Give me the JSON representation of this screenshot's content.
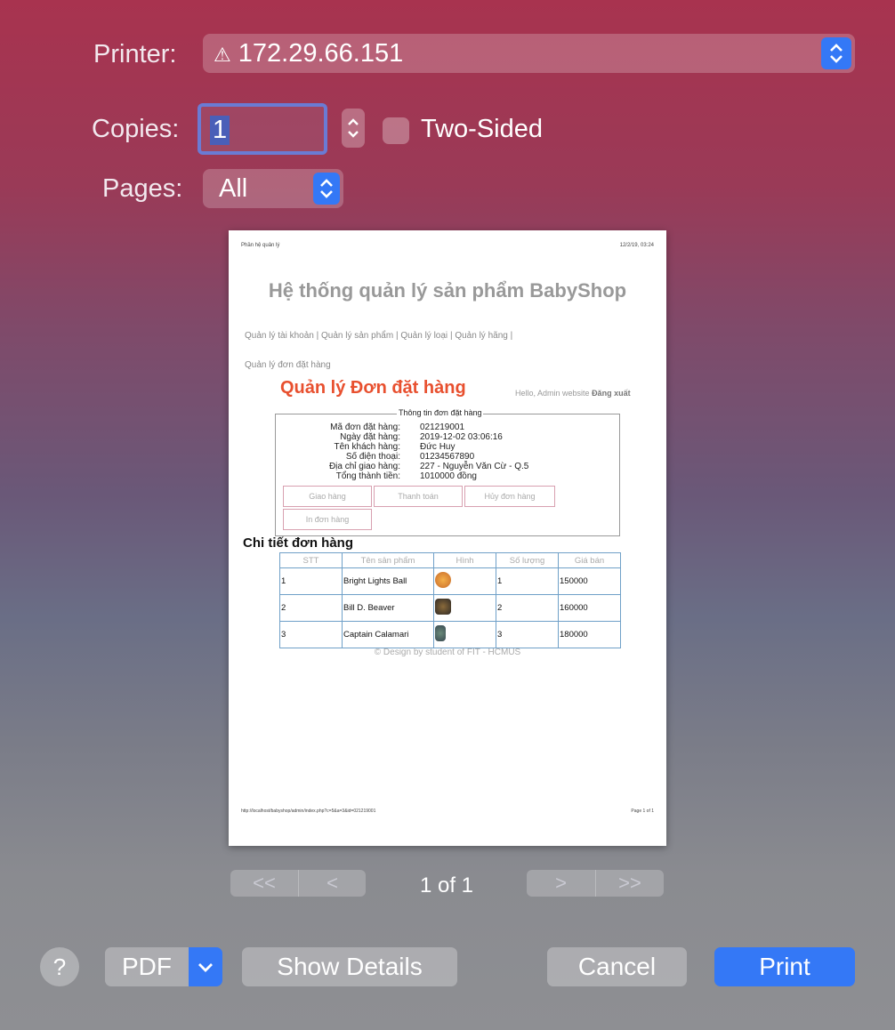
{
  "printer": {
    "label": "Printer:",
    "value": "172.29.66.151"
  },
  "copies": {
    "label": "Copies:",
    "value": "1"
  },
  "two_sided": {
    "label": "Two-Sided",
    "checked": false
  },
  "pages": {
    "label": "Pages:",
    "value": "All"
  },
  "preview": {
    "header_left": "Phần hệ quản lý",
    "header_right": "12/2/19, 03:24",
    "site_title": "Hệ thống quản lý sản phẩm BabyShop",
    "nav": [
      "Quản lý tài khoản",
      "Quản lý sản phẩm",
      "Quản lý loại",
      "Quản lý hãng",
      "Quản lý đơn đặt hàng"
    ],
    "nav_sep": "|",
    "page_title": "Quản lý Đơn đặt hàng",
    "hello": "Hello, Admin website",
    "logout": "Đăng xuất",
    "info_legend": "Thông tin đơn đặt hàng",
    "info": [
      {
        "label": "Mã đơn đặt hàng:",
        "value": "021219001"
      },
      {
        "label": "Ngày đặt hàng:",
        "value": "2019-12-02 03:06:16"
      },
      {
        "label": "Tên khách hàng:",
        "value": "Đức Huy"
      },
      {
        "label": "Số điện thoại:",
        "value": "01234567890"
      },
      {
        "label": "Địa chỉ giao hàng:",
        "value": "227 - Nguyễn Văn Cừ - Q.5"
      },
      {
        "label": "Tổng thành tiền:",
        "value": "1010000 đồng"
      }
    ],
    "buttons": [
      "Giao hàng",
      "Thanh toán",
      "Hủy đơn hàng",
      "In đơn hàng"
    ],
    "detail_title": "Chi tiết đơn hàng",
    "table_headers": [
      "STT",
      "Tên sản phẩm",
      "Hình",
      "Số lượng",
      "Giá bán"
    ],
    "rows": [
      {
        "stt": "1",
        "name": "Bright Lights Ball",
        "qty": "1",
        "price": "150000"
      },
      {
        "stt": "2",
        "name": "Bill D. Beaver",
        "qty": "2",
        "price": "160000"
      },
      {
        "stt": "3",
        "name": "Captain Calamari",
        "qty": "3",
        "price": "180000"
      }
    ],
    "copyright": "© Design by student of FIT - HCMUS",
    "footer_url": "http://localhost/babyshop/admin/index.php?c=5&a=3&id=021219001",
    "footer_page": "Page 1 of 1"
  },
  "pager": {
    "first": "<<",
    "prev": "<",
    "next": ">",
    "last": ">>",
    "status": "1 of 1"
  },
  "bottom": {
    "help": "?",
    "pdf": "PDF",
    "show_details": "Show Details",
    "cancel": "Cancel",
    "print": "Print"
  },
  "colors": {
    "accent": "#3478f6",
    "order_title": "#e8502f"
  }
}
